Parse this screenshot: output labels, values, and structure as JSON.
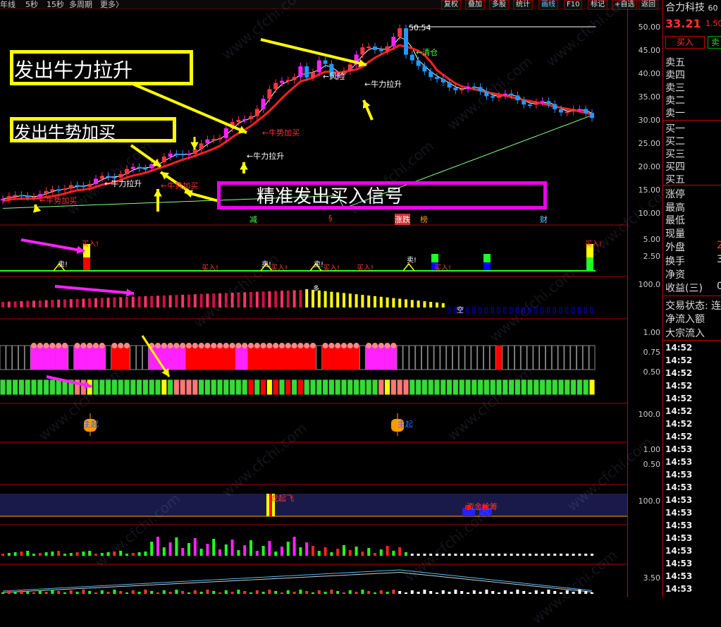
{
  "toolbar": {
    "left_items": [
      "年线",
      "5秒",
      "15秒",
      "多周期",
      "更多〉"
    ],
    "buttons": [
      "复权",
      "叠加",
      "多股",
      "统计",
      "画线",
      "F10",
      "标记",
      "+自选",
      "返回"
    ]
  },
  "stock": {
    "name": "合力科技",
    "name_suffix": "60",
    "price": "33.21",
    "change": "1.50",
    "buy_button": "买入",
    "sell_button": "卖"
  },
  "quote_rows": {
    "ask": [
      "卖五",
      "卖四",
      "卖三",
      "卖二",
      "卖一"
    ],
    "bid": [
      "买一",
      "买二",
      "买三",
      "买四",
      "买五"
    ],
    "stats": [
      "涨停",
      "最高",
      "最低",
      "现量",
      "外盘",
      "换手",
      "净资",
      "收益(三)"
    ],
    "stats_values": [
      "",
      "",
      "",
      "",
      "2",
      "3",
      "",
      "0"
    ],
    "trade_state": "交易状态: 连",
    "net_inflow": "净流入额",
    "big_inflow": "大宗流入",
    "ticks": [
      "14:52",
      "14:52",
      "14:52",
      "14:52",
      "14:52",
      "14:52",
      "14:52",
      "14:52",
      "14:53",
      "14:53",
      "14:53",
      "14:53",
      "14:53",
      "14:53",
      "14:53",
      "14:53",
      "14:53",
      "14:53",
      "14:53",
      "14:53"
    ]
  },
  "axes": {
    "price_ticks": [
      "50.00",
      "45.00",
      "40.00",
      "35.00",
      "30.00",
      "25.00",
      "20.00",
      "15.00",
      "10.00"
    ],
    "p2_ticks": [
      "5.00",
      "2.50"
    ],
    "p3_ticks": [
      "100.0"
    ],
    "p4_ticks": [
      "1.00",
      "0.75",
      "0.50"
    ],
    "p5_ticks": [
      "100.0"
    ],
    "p6_ticks": [
      "1.00",
      "0.50"
    ],
    "p7_ticks": [
      "100.0"
    ],
    "p9_ticks": [
      "3.50"
    ]
  },
  "callouts": {
    "box1": "发出牛力拉升",
    "box2": "发出牛势加买",
    "box3": "精准发出买入信号"
  },
  "chart_labels": {
    "peak": "50.54",
    "qingcang": "←清仓",
    "fengxian": "←风险",
    "niuli1": "←牛力拉升",
    "niuli2": "←牛力拉升",
    "niuli3": "←牛力拉升",
    "niushi1": "←牛势加买",
    "niushi2": "←牛势加买",
    "niushi3": "←牛势加买",
    "jian": "减",
    "s": "§",
    "zhangdie": "涨跌",
    "bang": "榜",
    "cai": "财",
    "buy_marks": [
      "买入!",
      "买入!",
      "买入!",
      "买入!",
      "买入!",
      "买入!",
      "买入!"
    ],
    "sell_marks": [
      "卖!",
      "卖!",
      "卖!",
      "卖!"
    ],
    "kong": "空",
    "duo": "多",
    "zhuqi": "主起",
    "zhuqi2": "主起",
    "longfei": "龙起飞",
    "qiangchou": "资金抢筹"
  },
  "watermark": "www.cfchi.com",
  "colors": {
    "up": "#ff3344",
    "down": "#2299ff",
    "magenta": "#ff22ff",
    "yellow": "#ffff00",
    "green": "#22ee22"
  }
}
